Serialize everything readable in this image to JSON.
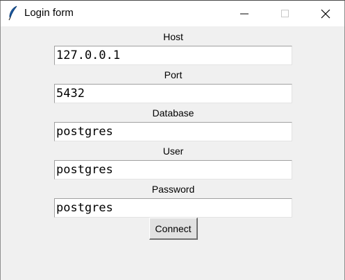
{
  "window": {
    "title": "Login form",
    "icon": "tk-feather-icon",
    "controls": {
      "minimize": "minimize-icon",
      "maximize": "maximize-icon",
      "close": "close-icon"
    }
  },
  "form": {
    "host": {
      "label": "Host",
      "value": "127.0.0.1"
    },
    "port": {
      "label": "Port",
      "value": "5432"
    },
    "database": {
      "label": "Database",
      "value": "postgres"
    },
    "user": {
      "label": "User",
      "value": "postgres"
    },
    "password": {
      "label": "Password",
      "value": "postgres"
    },
    "connect_label": "Connect"
  }
}
